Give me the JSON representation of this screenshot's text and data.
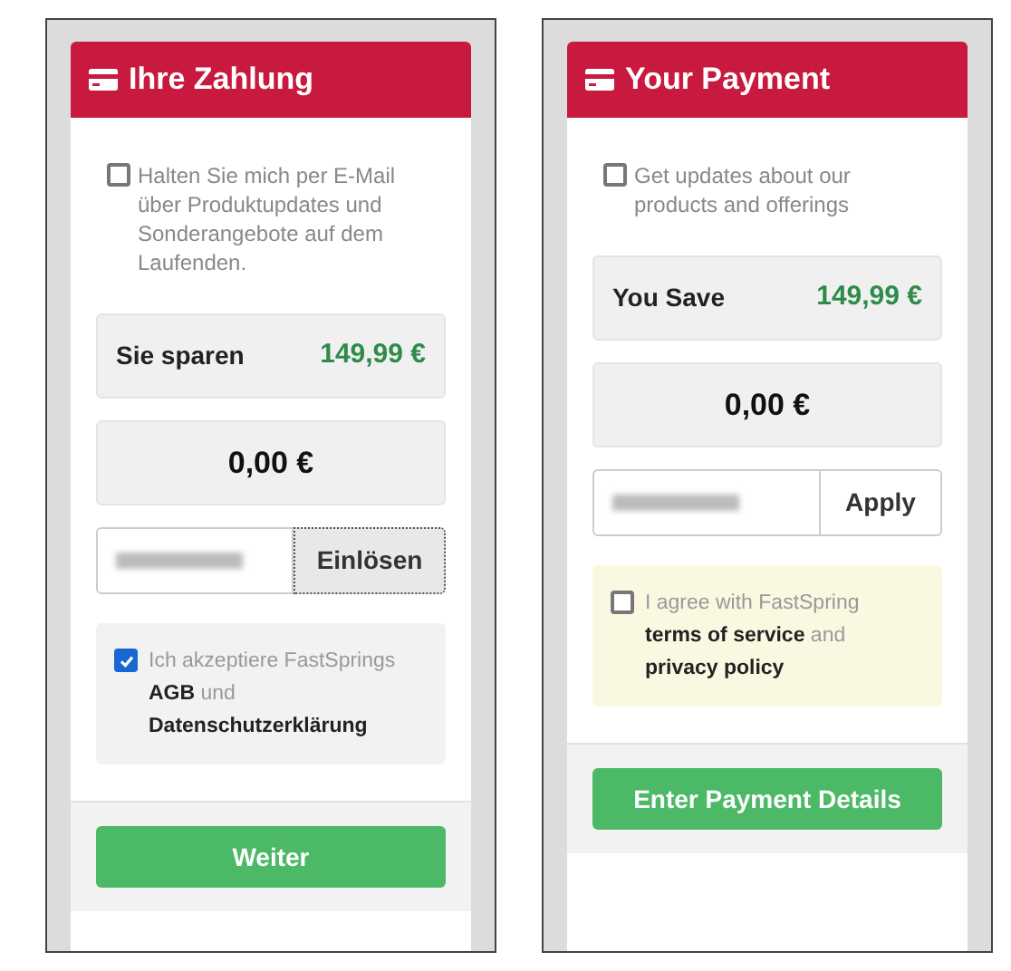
{
  "panels": [
    {
      "title": "Ihre Zahlung",
      "newsletter": {
        "label": "Halten Sie mich per E-Mail über Produktupdates und Sonderangebote auf dem Laufenden.",
        "checked": false
      },
      "savings": {
        "label": "Sie sparen",
        "amount": "149,99 €"
      },
      "total": "0,00 €",
      "coupon": {
        "button": "Einlösen",
        "focused": true
      },
      "agreement": {
        "checked": true,
        "segments": [
          {
            "text": "Ich akzeptiere FastSprings",
            "link": false
          },
          {
            "text": "AGB",
            "link": true
          },
          {
            "text": "und",
            "link": false
          },
          {
            "text": "Datenschutzerklärung",
            "link": true
          }
        ]
      },
      "submit": "Weiter"
    },
    {
      "title": "Your Payment",
      "newsletter": {
        "label": "Get updates about our products and offerings",
        "checked": false
      },
      "savings": {
        "label": "You Save",
        "amount": "149,99 €"
      },
      "total": "0,00 €",
      "coupon": {
        "button": "Apply",
        "focused": false
      },
      "agreement": {
        "checked": false,
        "segments": [
          {
            "text": "I agree with FastSpring",
            "link": false
          },
          {
            "text": "terms of service",
            "link": true
          },
          {
            "text": "and",
            "link": false
          },
          {
            "text": "privacy policy",
            "link": true
          }
        ]
      },
      "submit": "Enter Payment Details"
    }
  ]
}
